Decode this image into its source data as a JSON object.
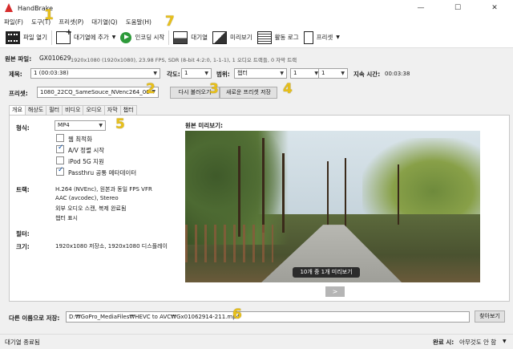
{
  "window": {
    "title": "HandBrake",
    "minimize": "—",
    "maximize": "☐",
    "close": "✕"
  },
  "menu": [
    "파일(F)",
    "도구(T)",
    "프리셋(P)",
    "대기열(Q)",
    "도움말(H)"
  ],
  "toolbar": {
    "open_source": "파일 열기",
    "add_to_queue": "대기열에 추가",
    "start_encode": "인코딩 시작",
    "queue": "대기열",
    "preview": "미리보기",
    "activity_log": "활동 로그",
    "presets": "프리셋"
  },
  "source": {
    "label": "원본 파일:",
    "name": "GX010629",
    "info": "1920x1080 (1920x1080), 23.98 FPS, SDR (8-bit 4:2:0, 1-1-1), 1 오디오 트랙들, 0 자막 트랙"
  },
  "title_row": {
    "title_label": "제목:",
    "title_value": "1 (00:03:38)",
    "angle_label": "각도:",
    "angle_value": "1",
    "range_label": "범위:",
    "range_type": "챕터",
    "range_start": "1",
    "range_dash": "-",
    "range_end": "1",
    "duration_label": "지속 시간:",
    "duration_value": "00:03:38"
  },
  "preset_row": {
    "label": "프리셋:",
    "value": "1080_22CQ_SameSouce_NVenc264_00",
    "reload_button": "다시 불러오기",
    "save_new_button": "새로운 프리셋 저장"
  },
  "tabs": [
    "개요",
    "해상도",
    "필터",
    "비디오",
    "오디오",
    "자막",
    "챕터"
  ],
  "summary": {
    "format_label": "형식:",
    "format_value": "MP4",
    "options": [
      {
        "label": "웹 최적화",
        "checked": false
      },
      {
        "label": "A/V 정렬 시작",
        "checked": true
      },
      {
        "label": "iPod 5G 지원",
        "checked": false
      },
      {
        "label": "Passthru 공통 메타데이터",
        "checked": true
      }
    ],
    "tracks_label": "트랙:",
    "tracks": [
      "H.264 (NVEnc), 원본과 동일 FPS VFR",
      "AAC (avcodec), Stereo",
      "외부 오디오 스캔, 복제 완료됨",
      "챕터 표시"
    ],
    "filters_label": "필터:",
    "size_label": "크기:",
    "size_value": "1920x1080 저장소, 1920x1080 디스플레이",
    "preview_label": "원본 미리보기:",
    "preview_caption": "10개 중 1개 미리보기",
    "next_button": ">"
  },
  "destination": {
    "label": "다른 이름으로 저장:",
    "path": "D:₩GoPro_MediaFiles₩HEVC to AVC₩Gx01062914-211.mp4",
    "browse_button": "찾아보기"
  },
  "status": {
    "left": "대기열 종료됨",
    "when_done_label": "완료 시:",
    "when_done_value": "아무것도 안 함"
  },
  "badges": [
    "1",
    "2",
    "3",
    "4",
    "5",
    "6",
    "7"
  ],
  "colors": {
    "badge": "#e8c01a",
    "start_green": "#2d9a3a",
    "app_icon": "#d62c2c"
  }
}
